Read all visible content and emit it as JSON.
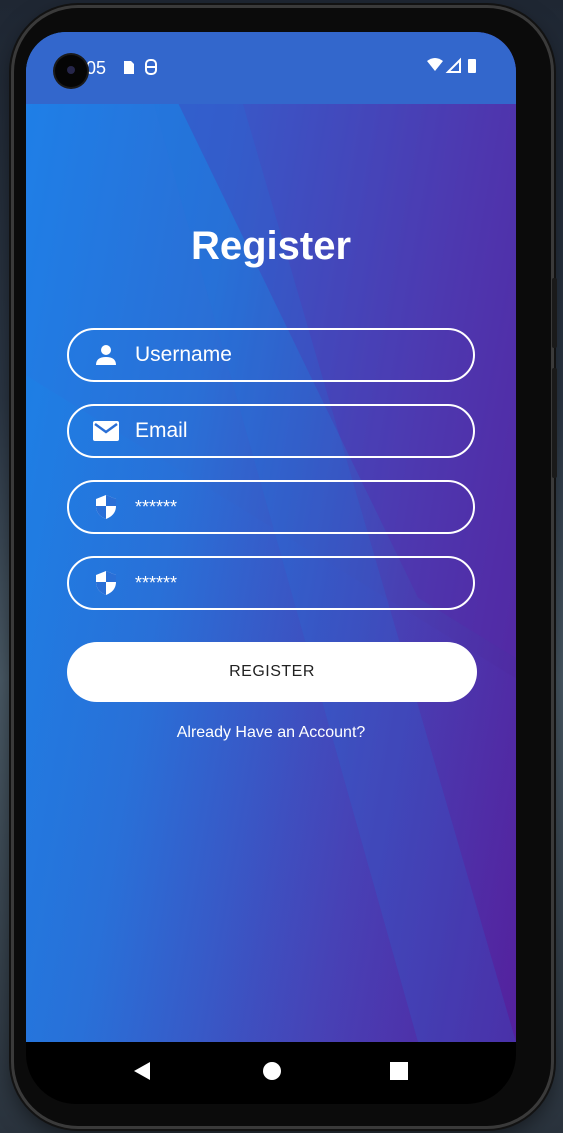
{
  "status": {
    "time": "05",
    "left_icons": "■ ◎",
    "right_icons": "▼◢▮"
  },
  "screen": {
    "title": "Register",
    "fields": [
      {
        "placeholder": "Username",
        "icon": "person-icon"
      },
      {
        "placeholder": "Email",
        "icon": "mail-icon"
      },
      {
        "value": "******",
        "icon": "shield-icon"
      },
      {
        "value": "******",
        "icon": "shield-icon"
      }
    ],
    "register_label": "REGISTER",
    "login_link": "Already Have an Account?"
  },
  "colors": {
    "gradient_start": "#1e80e8",
    "gradient_end": "#531f9a",
    "statusbar": "#3367cc"
  }
}
